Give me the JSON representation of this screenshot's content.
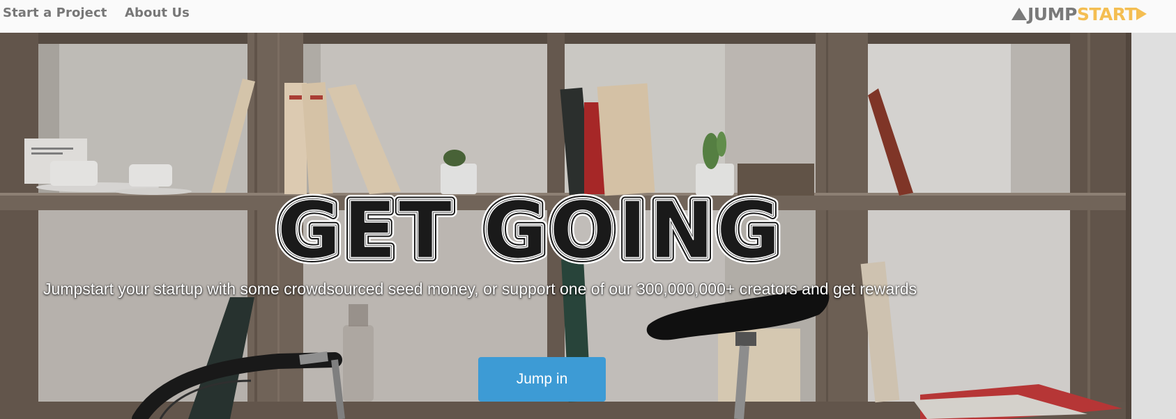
{
  "nav": {
    "start_project": "Start a Project",
    "about_us": "About Us"
  },
  "brand": {
    "part1": "JUMP",
    "part2": "START",
    "colors": {
      "gray": "#7a7a7a",
      "accent": "#f4be52"
    }
  },
  "hero": {
    "title": "GET GOING",
    "subtitle": "Jumpstart your startup with some crowdsourced seed money, or support one of our 300,000,000+ creators and get rewards",
    "button_label": "Jump in",
    "button_color": "#3d9bd5"
  }
}
